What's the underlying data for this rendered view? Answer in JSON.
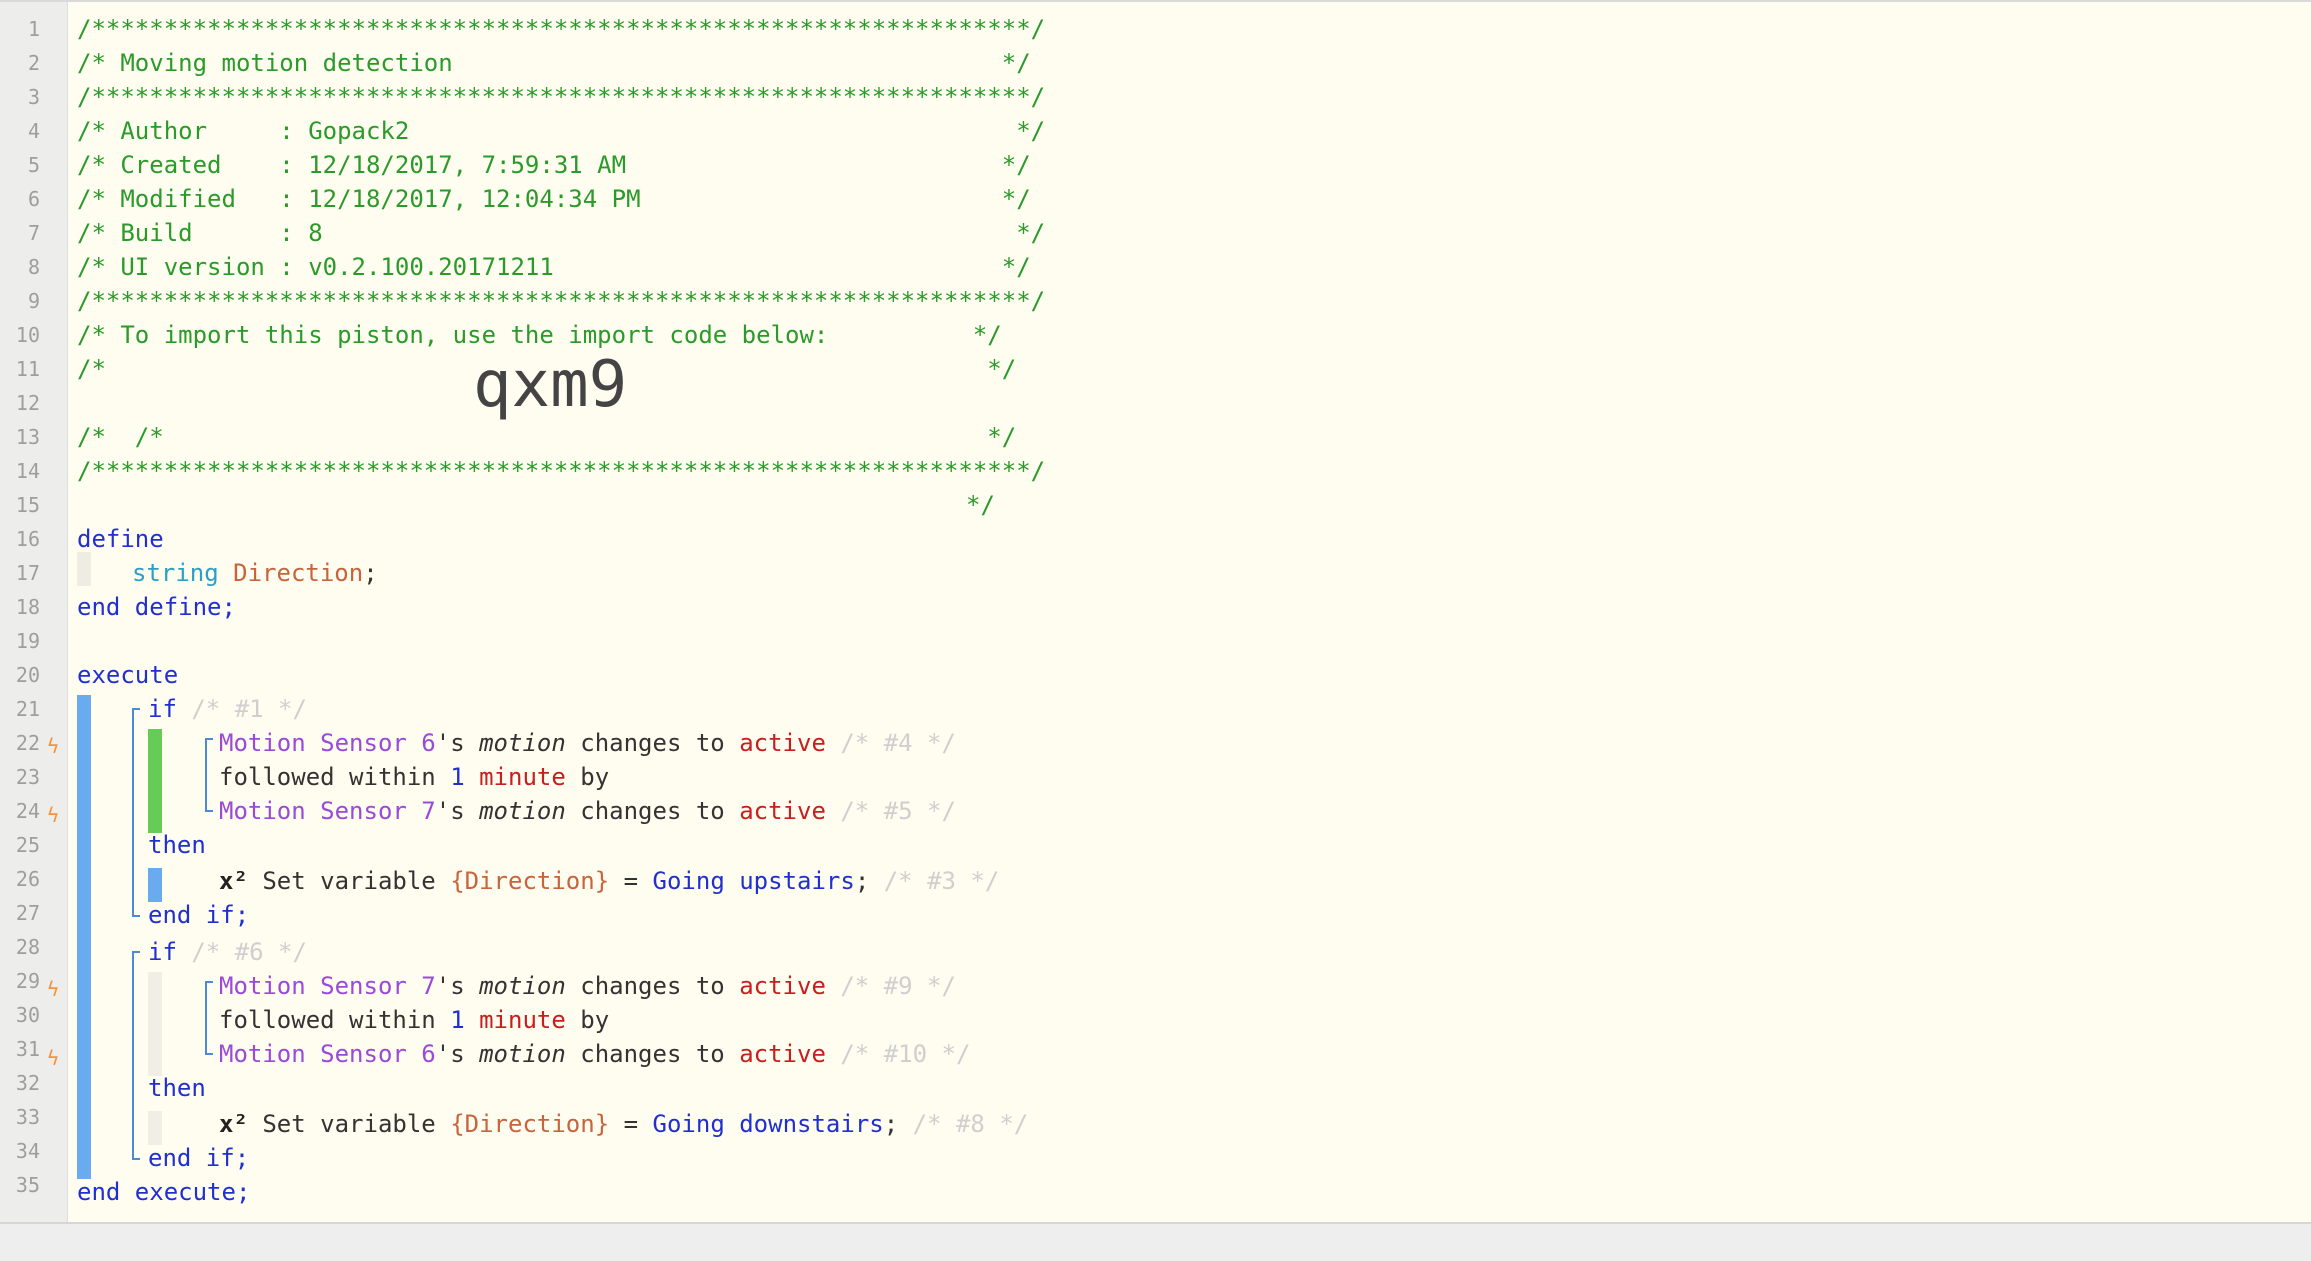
{
  "line_numbers": [
    "1",
    "2",
    "3",
    "4",
    "5",
    "6",
    "7",
    "8",
    "9",
    "10",
    "11",
    "12",
    "13",
    "14",
    "15",
    "16",
    "17",
    "18",
    "19",
    "20",
    "21",
    "22",
    "23",
    "24",
    "25",
    "26",
    "27",
    "28",
    "29",
    "30",
    "31",
    "32",
    "33",
    "34",
    "35"
  ],
  "header": {
    "stars": "/*****************************************************************/",
    "title": "/* Moving motion detection                                      */",
    "author": "/* Author     : Gopack2                                          */",
    "created": "/* Created    : 12/18/2017, 7:59:31 AM                          */",
    "modified": "/* Modified   : 12/18/2017, 12:04:34 PM                         */",
    "build": "/* Build      : 8                                                */",
    "ui_version": "/* UI version : v0.2.100.20171211                               */",
    "import_line": "/* To import this piston, use the import code below:          */",
    "blank": "/*                                                             */",
    "blank_prefix": "/*",
    "blank_suffix": "*/",
    "import_code": "qxm9"
  },
  "code": {
    "define": "define",
    "string_type": "string",
    "var_name": "Direction",
    "semicolon": ";",
    "end_define": "end define;",
    "execute": "execute",
    "if": "if",
    "then": "then",
    "end_if": "end if;",
    "end_execute": "end execute;",
    "followed_within": "followed within",
    "one": "1",
    "minute": "minute",
    "by": "by",
    "s_motion_prefix": "'s ",
    "motion": "motion",
    "changes_to": " changes to ",
    "active": "active",
    "x2": "x²",
    "set_variable": " Set variable ",
    "var_ref": "{Direction}",
    "equals": " = ",
    "going": "Going",
    "upstairs": "upstairs",
    "downstairs": "downstairs",
    "sensor_name": "Motion Sensor ",
    "sensor_6": "6",
    "sensor_7": "7",
    "id1": "/* #1 */",
    "id4": "/* #4 */",
    "id5": "/* #5 */",
    "id3": "/* #3 */",
    "id6": "/* #6 */",
    "id9": "/* #9 */",
    "id10": "/* #10 */",
    "id8": "/* #8 */"
  },
  "colors": {
    "background": "#fffcf0",
    "comment": "#2a9a2a",
    "keyword": "#2030d0",
    "device": "#9a4ad8",
    "value": "#c81e1e",
    "variable": "#c8643c",
    "block_blue": "#6aabf0",
    "block_green": "#66cc55",
    "trigger_bolt": "#f5923e"
  }
}
